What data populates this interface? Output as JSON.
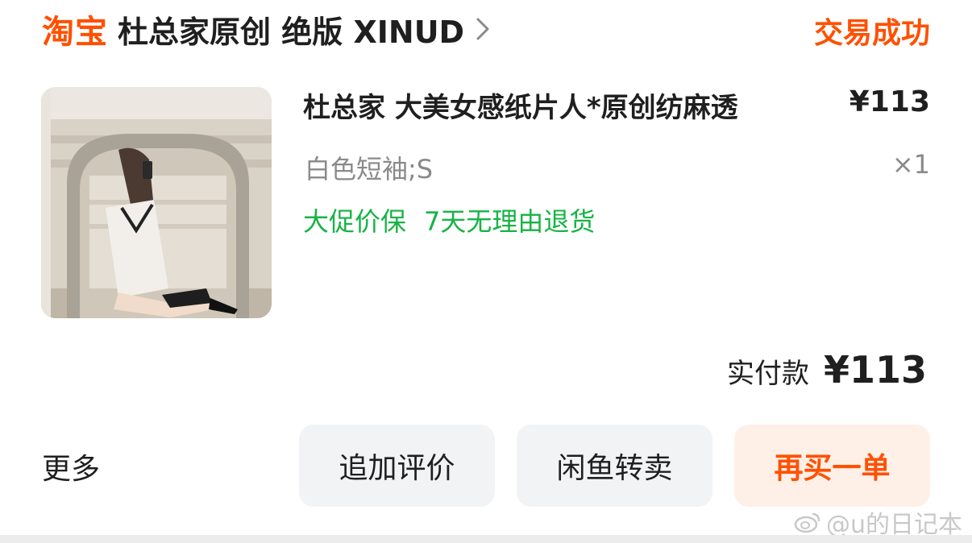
{
  "header": {
    "logo_text": "淘宝",
    "shop_name": "杜总家原创 绝版 XINUD",
    "status": "交易成功"
  },
  "item": {
    "title": "杜总家 大美女感纸片人*原创纺麻透",
    "price": "¥113",
    "sku": "白色短袖;S",
    "quantity": "×1",
    "tags": [
      "大促价保",
      "7天无理由退货"
    ]
  },
  "payment": {
    "label": "实付款",
    "amount": "¥113"
  },
  "actions": {
    "more": "更多",
    "review": "追加评价",
    "resell": "闲鱼转卖",
    "rebuy": "再买一单"
  },
  "watermark": "@u的日记本",
  "colors": {
    "brand": "#ff5000",
    "tag_green": "#17b345",
    "muted": "#8a8a8a",
    "button_bg": "#f2f3f5",
    "primary_button_bg": "#fff0e7"
  }
}
